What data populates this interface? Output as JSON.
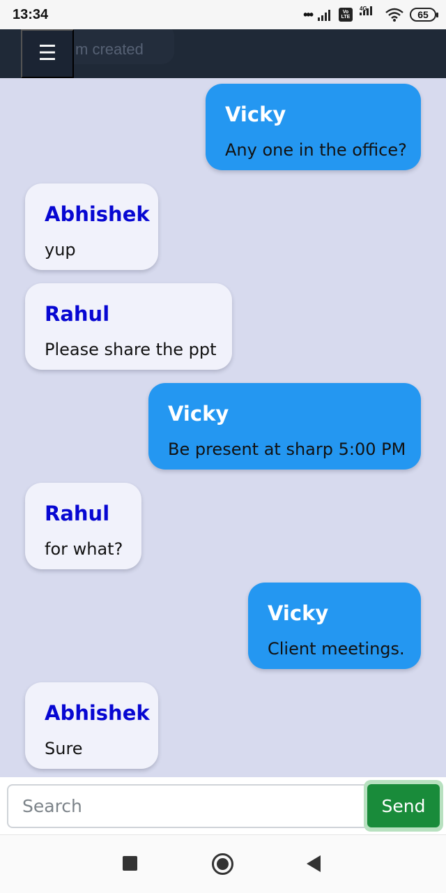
{
  "status_bar": {
    "time": "13:34",
    "network": "4G",
    "volte": "Vo LTE",
    "battery": "65"
  },
  "top_bar": {
    "menu_icon": "☰",
    "hidden_text": "m created"
  },
  "messages": [
    {
      "sender": "Vicky",
      "text": "Any one in the office?",
      "direction": "outgoing"
    },
    {
      "sender": "Abhishek",
      "text": "yup",
      "direction": "incoming"
    },
    {
      "sender": "Rahul",
      "text": "Please share the ppt",
      "direction": "incoming"
    },
    {
      "sender": "Vicky",
      "text": "Be present at sharp 5:00 PM",
      "direction": "outgoing"
    },
    {
      "sender": "Rahul",
      "text": "for what?",
      "direction": "incoming"
    },
    {
      "sender": "Vicky",
      "text": "Client meetings.",
      "direction": "outgoing"
    },
    {
      "sender": "Abhishek",
      "text": "Sure",
      "direction": "incoming"
    }
  ],
  "composer": {
    "placeholder": "Search",
    "send_label": "Send"
  },
  "colors": {
    "outgoing_bubble": "#2497f1",
    "incoming_bubble": "#f1f2fb",
    "incoming_sender": "#0707d2",
    "send_button": "#198b3a"
  },
  "icons": {
    "menu": "hamburger-menu-icon",
    "wifi": "wifi-icon",
    "battery": "battery-icon",
    "recents": "recent-apps-icon",
    "home": "home-icon",
    "back": "back-icon"
  }
}
